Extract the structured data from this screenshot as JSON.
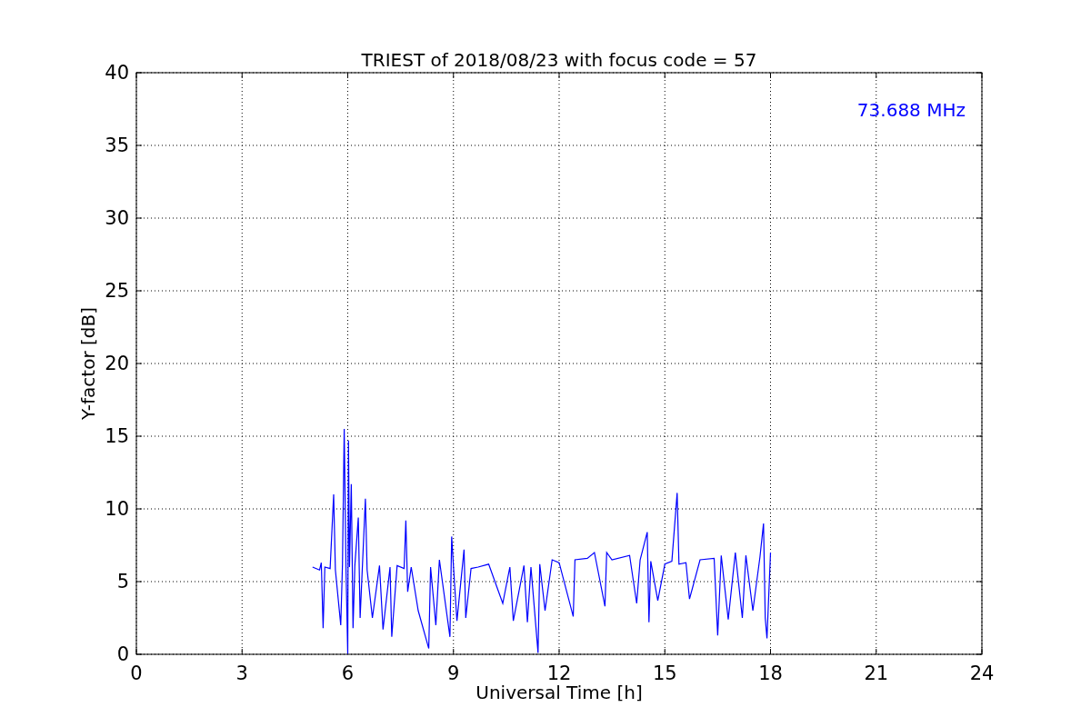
{
  "figure": {
    "chart_data": {
      "type": "line",
      "title": "TRIEST of 2018/08/23 with focus code = 57",
      "xlabel": "Universal Time [h]",
      "ylabel": "Y-factor [dB]",
      "xlim": [
        0,
        24
      ],
      "ylim": [
        0,
        40
      ],
      "xticks": [
        0,
        3,
        6,
        9,
        12,
        15,
        18,
        21,
        24
      ],
      "yticks": [
        0,
        5,
        10,
        15,
        20,
        25,
        30,
        35,
        40
      ],
      "x": [
        5.0,
        5.2,
        5.25,
        5.3,
        5.35,
        5.5,
        5.6,
        5.65,
        5.8,
        5.85,
        5.9,
        5.95,
        6.0,
        6.02,
        6.05,
        6.1,
        6.15,
        6.2,
        6.3,
        6.35,
        6.5,
        6.55,
        6.7,
        6.9,
        7.0,
        7.2,
        7.25,
        7.4,
        7.6,
        7.65,
        7.7,
        7.8,
        8.0,
        8.3,
        8.35,
        8.5,
        8.6,
        8.9,
        8.95,
        9.0,
        9.1,
        9.3,
        9.35,
        9.5,
        9.7,
        10.0,
        10.4,
        10.6,
        10.7,
        11.0,
        11.1,
        11.2,
        11.4,
        11.45,
        11.6,
        11.8,
        12.0,
        12.4,
        12.45,
        12.8,
        13.0,
        13.3,
        13.35,
        13.5,
        14.0,
        14.2,
        14.3,
        14.5,
        14.55,
        14.6,
        14.8,
        15.0,
        15.2,
        15.35,
        15.4,
        15.6,
        15.7,
        16.0,
        16.4,
        16.5,
        16.6,
        16.8,
        17.0,
        17.2,
        17.3,
        17.5,
        17.7,
        17.8,
        17.85,
        17.9,
        18.0
      ],
      "series": [
        {
          "color": "#0000ff",
          "values": [
            6.0,
            5.8,
            6.3,
            1.8,
            6.0,
            5.9,
            11.0,
            5.8,
            2.0,
            6.2,
            15.5,
            5.8,
            0.0,
            14.7,
            6.0,
            11.7,
            1.8,
            6.1,
            9.4,
            2.5,
            10.7,
            5.8,
            2.5,
            6.1,
            1.7,
            6.0,
            1.2,
            6.1,
            5.9,
            9.2,
            4.3,
            6.0,
            3.0,
            0.4,
            6.0,
            2.0,
            6.5,
            1.2,
            8.1,
            6.0,
            2.3,
            7.2,
            2.5,
            5.9,
            6.0,
            6.2,
            3.5,
            6.0,
            2.3,
            6.1,
            2.2,
            6.0,
            0.1,
            6.2,
            3.0,
            6.5,
            6.3,
            2.6,
            6.5,
            6.6,
            7.0,
            3.3,
            7.0,
            6.5,
            6.8,
            3.5,
            6.5,
            8.4,
            2.2,
            6.4,
            3.7,
            6.2,
            6.4,
            11.1,
            6.2,
            6.3,
            3.8,
            6.5,
            6.6,
            1.3,
            6.8,
            2.4,
            7.0,
            2.5,
            6.8,
            3.0,
            6.7,
            9.0,
            2.5,
            1.1,
            7.0
          ]
        }
      ],
      "grid": true,
      "annotations": [
        {
          "text": "73.688 MHz"
        }
      ]
    }
  }
}
